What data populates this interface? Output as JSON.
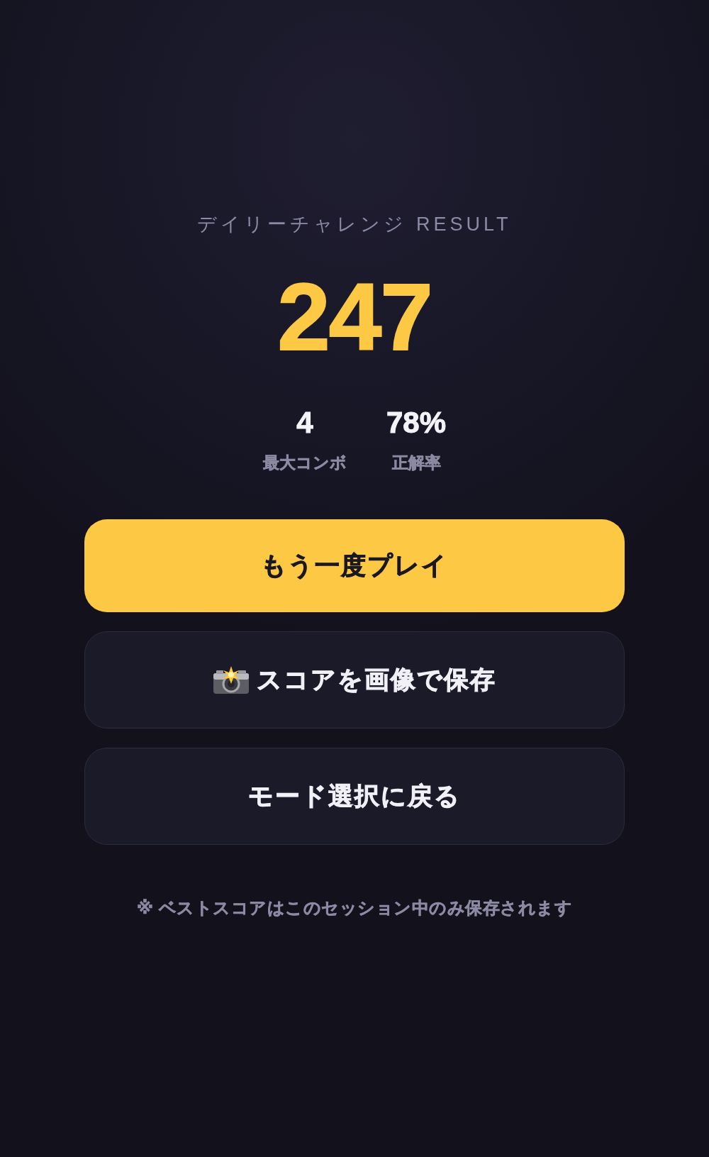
{
  "header": {
    "subtitle": "デイリーチャレンジ RESULT",
    "score": "247"
  },
  "stats": [
    {
      "value": "4",
      "label": "最大コンボ"
    },
    {
      "value": "78%",
      "label": "正解率"
    }
  ],
  "buttons": [
    {
      "kind": "primary",
      "label": "もう一度プレイ"
    },
    {
      "kind": "share",
      "label": "スコアを画像で保存"
    },
    {
      "kind": "secondary",
      "label": "モード選択に戻る"
    }
  ],
  "note": "※ ベストスコアはこのセッション中のみ保存されます"
}
